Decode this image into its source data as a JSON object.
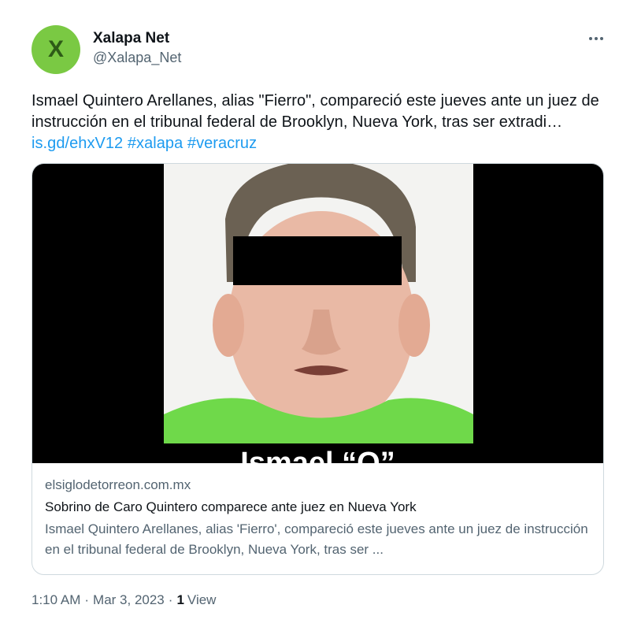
{
  "author": {
    "avatar_letter": "X",
    "name": "Xalapa Net",
    "handle": "@Xalapa_Net"
  },
  "tweet": {
    "text": "Ismael Quintero Arellanes, alias \"Fierro\", compareció este jueves ante un juez de instrucción en el tribunal federal de Brooklyn, Nueva York, tras ser extradi… ",
    "link": "is.gd/ehxV12",
    "hashtags": [
      "#xalapa",
      "#veracruz"
    ]
  },
  "card": {
    "image_caption": "Ismael “Q”",
    "domain": "elsiglodetorreon.com.mx",
    "title": "Sobrino de Caro Quintero comparece ante juez en Nueva York",
    "description": "Ismael Quintero Arellanes, alias 'Fierro', compareció este jueves ante un juez de instrucción en el tribunal federal de Brooklyn, Nueva York, tras ser ..."
  },
  "footer": {
    "time": "1:10 AM",
    "date": "Mar 3, 2023",
    "separator": "·",
    "views_count": "1",
    "views_label": "View"
  },
  "colors": {
    "link": "#1d9bf0",
    "avatar_bg": "#7ac943",
    "shirt": "#6fd94a"
  },
  "icons": {
    "more": "more-horizontal-icon"
  }
}
